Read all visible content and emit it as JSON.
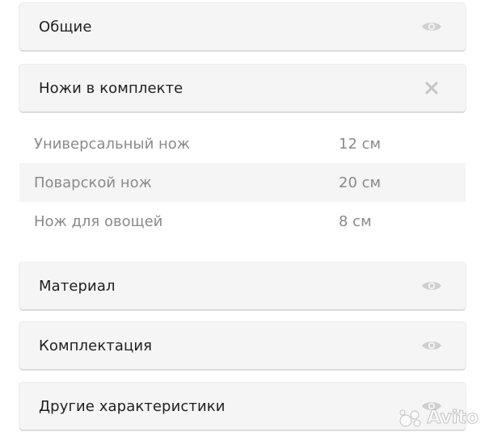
{
  "sections": {
    "general": {
      "title": "Общие",
      "icon": "eye-icon"
    },
    "knives": {
      "title": "Ножи в комплекте",
      "icon": "close-icon"
    },
    "material": {
      "title": "Материал",
      "icon": "eye-icon"
    },
    "kit": {
      "title": "Комплектация",
      "icon": "eye-icon"
    },
    "other": {
      "title": "Другие характеристики",
      "icon": "eye-icon"
    }
  },
  "knives_table": [
    {
      "name": "Универсальный нож",
      "value": "12 см"
    },
    {
      "name": "Поварской нож",
      "value": "20 см"
    },
    {
      "name": "Нож для овощей",
      "value": "8 см"
    }
  ],
  "watermark": {
    "text": "Avito"
  },
  "colors": {
    "card_bg": "#f5f5f5",
    "icon": "#cfcfcf",
    "muted_text": "#8a8a8a"
  }
}
